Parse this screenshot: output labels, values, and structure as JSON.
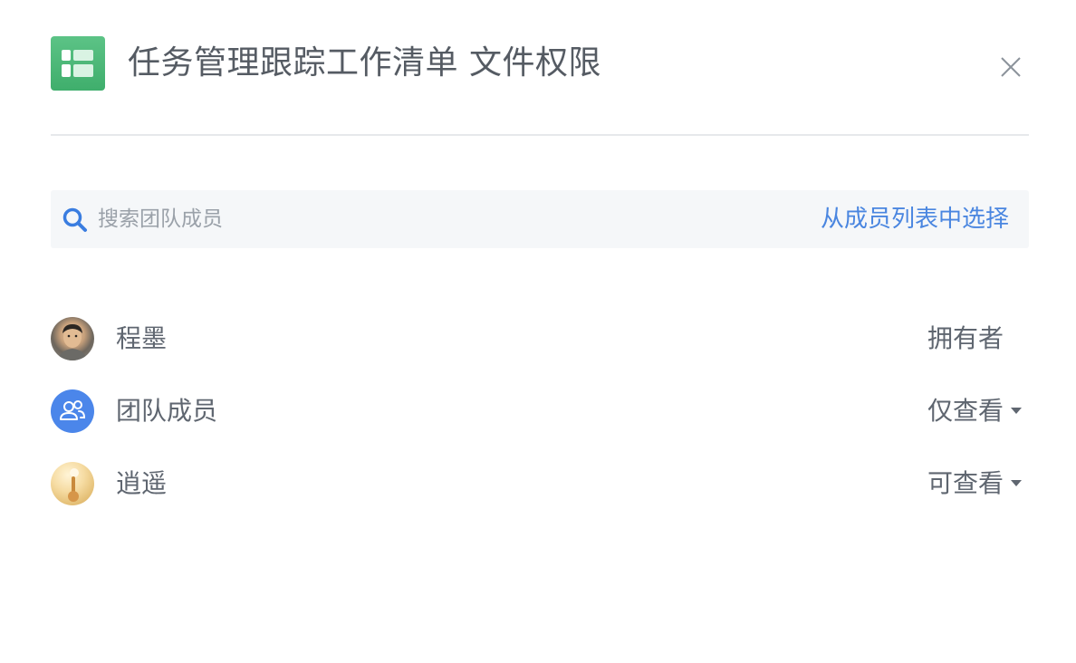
{
  "header": {
    "title": "任务管理跟踪工作清单 文件权限",
    "file_icon": "spreadsheet-icon",
    "close_icon": "close-icon",
    "accent_color": "#4cb878"
  },
  "search": {
    "placeholder": "搜索团队成员",
    "value": "",
    "pick_from_list": "从成员列表中选择",
    "link_color": "#4a86e0"
  },
  "members": [
    {
      "name": "程墨",
      "role": "拥有者",
      "avatar": "user-photo",
      "has_dropdown": false
    },
    {
      "name": "团队成员",
      "role": "仅查看",
      "avatar": "team-icon",
      "has_dropdown": true
    },
    {
      "name": "逍遥",
      "role": "可查看",
      "avatar": "user-photo",
      "has_dropdown": true
    }
  ]
}
